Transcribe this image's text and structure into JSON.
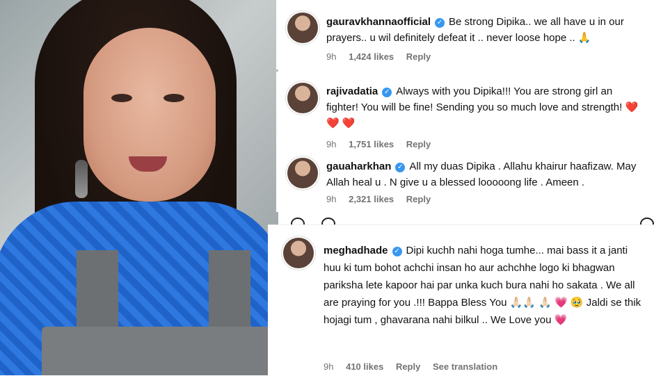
{
  "comments": [
    {
      "username": "gauravkhannaofficial",
      "text": "Be strong Dipika.. we all have u in our prayers.. u wil definitely defeat it .. never loose hope .. 🙏",
      "time": "9h",
      "likes": "1,424 likes",
      "reply": "Reply"
    },
    {
      "username": "rajivadatia",
      "text": "Always with you Dipika!!! You are strong girl an fighter! You will be fine! Sending you so much love and strength! ❤️ ❤️ ❤️",
      "time": "9h",
      "likes": "1,751 likes",
      "reply": "Reply"
    },
    {
      "username": "gauaharkhan",
      "text": "All my duas Dipika . Allahu khairur haafizaw. May Allah heal u . N give u a blessed looooong life . Ameen .",
      "time": "9h",
      "likes": "2,321 likes",
      "reply": "Reply"
    },
    {
      "username": "meghadhade",
      "text": "Dipi kuchh nahi hoga tumhe... mai bass it a janti huu ki tum bohot achchi insan ho aur achchhe logo ki bhagwan pariksha lete kapoor hai par unka kuch bura nahi ho sakata . We all are praying for you .!!! Bappa Bless You 🙏🏻🙏🏻 🙏🏻 💗 🥹 Jaldi se thik hojagi tum , ghavarana nahi bilkul .. We Love you 💗",
      "time": "9h",
      "likes": "410 likes",
      "reply": "Reply",
      "translation": "See translation"
    }
  ],
  "icons": {
    "verified": "verified-badge-icon"
  },
  "colors": {
    "verified": "#3897f0",
    "meta": "#737373",
    "outfit": "#1f63c8"
  }
}
